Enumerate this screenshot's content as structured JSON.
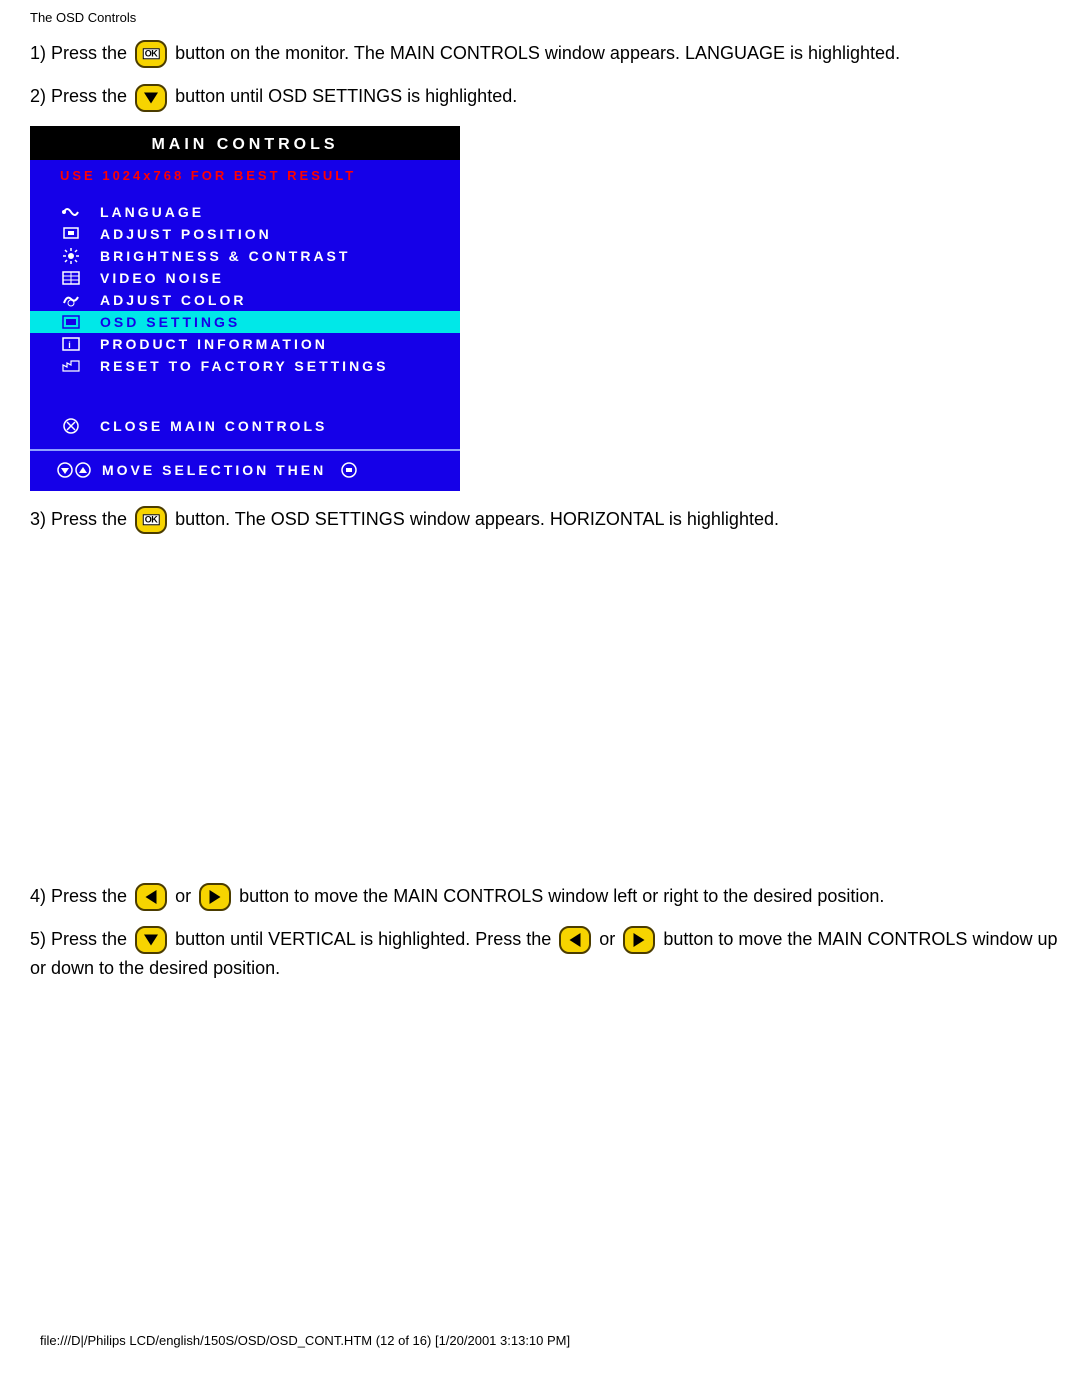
{
  "header": "The OSD Controls",
  "steps": {
    "s1a": "1) Press the ",
    "s1b": " button on the monitor. The MAIN CONTROLS window appears. LANGUAGE is highlighted.",
    "s2a": "2) Press the ",
    "s2b": " button until OSD SETTINGS is highlighted.",
    "s3a": "3) Press the ",
    "s3b": " button. The OSD SETTINGS window appears. HORIZONTAL is highlighted.",
    "s4a": "4) Press the ",
    "s4or": " or ",
    "s4b": " button to move the MAIN CONTROLS window left or right to the desired position.",
    "s5a": "5) Press the ",
    "s5b": " button until VERTICAL is highlighted. Press the ",
    "s5or": " or ",
    "s5c": " button to move the MAIN CONTROLS window up or down to the desired position."
  },
  "osd": {
    "title": "MAIN CONTROLS",
    "hint": "USE 1024x768 FOR BEST RESULT",
    "items": [
      {
        "label": "LANGUAGE"
      },
      {
        "label": "ADJUST POSITION"
      },
      {
        "label": "BRIGHTNESS & CONTRAST"
      },
      {
        "label": "VIDEO NOISE"
      },
      {
        "label": "ADJUST COLOR"
      },
      {
        "label": "OSD SETTINGS"
      },
      {
        "label": "PRODUCT INFORMATION"
      },
      {
        "label": "RESET TO FACTORY SETTINGS"
      }
    ],
    "close": "CLOSE MAIN CONTROLS",
    "footer": "MOVE SELECTION THEN"
  },
  "button_labels": {
    "ok": "OK"
  },
  "footer": "file:///D|/Philips LCD/english/150S/OSD/OSD_CONT.HTM (12 of 16) [1/20/2001 3:13:10 PM]"
}
